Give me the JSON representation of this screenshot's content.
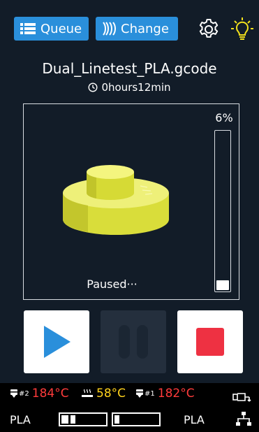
{
  "toolbar": {
    "queue_label": "Queue",
    "change_label": "Change",
    "accent_color": "#2a8fdb",
    "icons": [
      "list-icon",
      "filament-change-icon",
      "gear-icon",
      "light-bulb-icon"
    ]
  },
  "job": {
    "filename": "Dual_Linetest_PLA.gcode",
    "duration": "0hours12min",
    "progress_text": "6%",
    "progress_fraction": 0.06,
    "status": "Paused···"
  },
  "controls": {
    "play_color": "#2a8fdb",
    "stop_color": "#ee3142"
  },
  "temperatures": {
    "nozzle2": {
      "label": "#2",
      "value": "184°C"
    },
    "bed": {
      "value": "58°C"
    },
    "nozzle1": {
      "label": "#1",
      "value": "182°C"
    },
    "hot_color": "#ff3b3b",
    "bed_color": "#ffd21c"
  },
  "materials": {
    "left": "PLA",
    "right": "PLA",
    "left_spool_fraction": 0.35,
    "right_spool_fraction": 0.12
  }
}
